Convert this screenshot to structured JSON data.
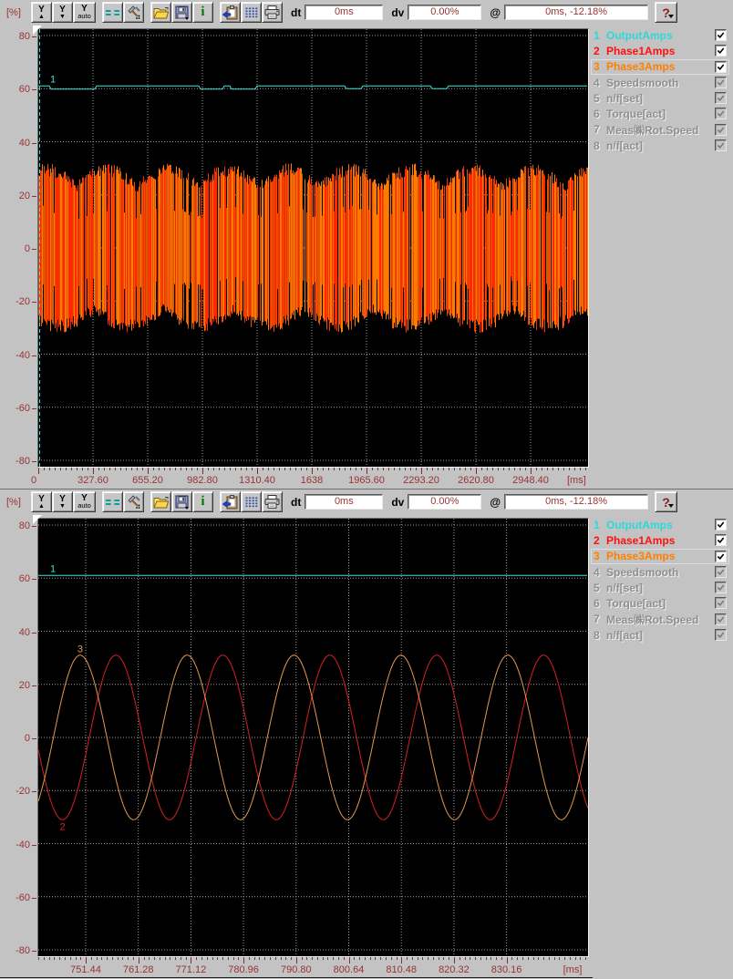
{
  "ui": {
    "btn_y": "Y",
    "btn_y_up_name": "y-zoom-in",
    "btn_y_down_name": "y-zoom-out",
    "btn_auto": "auto",
    "btn_info": "i",
    "btn_help": "?",
    "dt_label": "dt",
    "dv_label": "dv",
    "at_label": "@"
  },
  "colors": {
    "window_bg": "#c3c3c3",
    "plot_bg": "#000000",
    "grid": "#c9c9c9",
    "axis_text": "#993333",
    "cyan": "#3ce2d8",
    "red": "#ff1414",
    "orange": "#ff8214",
    "disabled_text": "#8f8f8f"
  },
  "channels": [
    {
      "num": "1",
      "name": "OutputAmps",
      "color": "#2dd8d8",
      "enabled": true,
      "checked": true,
      "selected": false
    },
    {
      "num": "2",
      "name": "Phase1Amps",
      "color": "#ff1010",
      "enabled": true,
      "checked": true,
      "selected": false
    },
    {
      "num": "3",
      "name": "Phase3Amps",
      "color": "#ff7f00",
      "enabled": true,
      "checked": true,
      "selected": true
    },
    {
      "num": "4",
      "name": "Speedsmooth",
      "color": "#8f8f8f",
      "enabled": false,
      "checked": true,
      "selected": false
    },
    {
      "num": "5",
      "name": "n/f[set]",
      "color": "#8f8f8f",
      "enabled": false,
      "checked": true,
      "selected": false
    },
    {
      "num": "6",
      "name": "Torque[act]",
      "color": "#8f8f8f",
      "enabled": false,
      "checked": true,
      "selected": false
    },
    {
      "num": "7",
      "name": "Meas㈱Rot.Speed",
      "color": "#8f8f8f",
      "enabled": false,
      "checked": true,
      "selected": false
    },
    {
      "num": "8",
      "name": "n/f[act]",
      "color": "#8f8f8f",
      "enabled": false,
      "checked": true,
      "selected": false
    }
  ],
  "panels": [
    {
      "y_unit": "[%]",
      "fields": {
        "dt": "0ms",
        "dv": "0.00%",
        "at": "0ms, -12.18%"
      }
    },
    {
      "y_unit": "[%]",
      "fields": {
        "dt": "0ms",
        "dv": "0.00%",
        "at": "0ms, -12.18%"
      }
    }
  ],
  "chart_data": [
    {
      "type": "line",
      "title": "trace overview - full record",
      "x_unit": "[ms]",
      "y_unit": "[%]",
      "x_tick_labels": [
        "0",
        "327.60",
        "655.20",
        "982.80",
        "1310.40",
        "1638",
        "1965.60",
        "2293.20",
        "2620.80",
        "2948.40"
      ],
      "x_ticks": [
        0,
        327.6,
        655.2,
        982.8,
        1310.4,
        1638,
        1965.6,
        2293.2,
        2620.8,
        2948.4
      ],
      "x_range": [
        0,
        3292.4
      ],
      "y_tick_labels": [
        "80",
        "60",
        "40",
        "20",
        "0",
        "-20",
        "-40",
        "-60",
        "-80"
      ],
      "y_ticks": [
        80,
        60,
        40,
        20,
        0,
        -20,
        -40,
        -60,
        -80
      ],
      "y_range": [
        -82.4,
        82.4
      ],
      "grid": true,
      "legend_position": "right",
      "cursor": {
        "at_ms": 0,
        "color": "#38e4e4",
        "style": "dashed"
      },
      "series": [
        {
          "name": "OutputAmps",
          "kind": "constant",
          "color": "#3ce2d8",
          "value_pct": 61,
          "curve_label": "1",
          "dips": [
            {
              "from_frac": 0.02,
              "to_frac": 0.105,
              "delta_pct": -1.2
            },
            {
              "from_frac": 0.295,
              "to_frac": 0.335,
              "delta_pct": -1.2
            },
            {
              "from_frac": 0.35,
              "to_frac": 0.395,
              "delta_pct": -1.2
            },
            {
              "from_frac": 0.56,
              "to_frac": 0.59,
              "delta_pct": -1.0
            },
            {
              "from_frac": 0.715,
              "to_frac": 0.745,
              "delta_pct": -1.0
            }
          ]
        },
        {
          "name": "Phase1Amps",
          "kind": "dense-band",
          "color": "#ff2800",
          "amplitude_pct": 32
        },
        {
          "name": "Phase3Amps",
          "kind": "dense-band",
          "color": "#ff7a00",
          "amplitude_pct": 32
        }
      ]
    },
    {
      "type": "line",
      "title": "trace zoom view",
      "x_unit": "[ms]",
      "y_unit": "[%]",
      "x_tick_labels": [
        "751.44",
        "761.28",
        "771.12",
        "780.96",
        "790.80",
        "800.64",
        "810.48",
        "820.32",
        "830.16"
      ],
      "x_ticks": [
        751.44,
        761.28,
        771.12,
        780.96,
        790.8,
        800.64,
        810.48,
        820.32,
        830.16
      ],
      "x_range": [
        742.57,
        845.4
      ],
      "y_tick_labels": [
        "80",
        "60",
        "40",
        "20",
        "0",
        "-20",
        "-40",
        "-60",
        "-80"
      ],
      "y_ticks": [
        80,
        60,
        40,
        20,
        0,
        -20,
        -40,
        -60,
        -80
      ],
      "y_range": [
        -82.4,
        82.4
      ],
      "grid": true,
      "legend_position": "right",
      "series": [
        {
          "name": "OutputAmps",
          "kind": "constant",
          "color": "#3ce2d8",
          "value_pct": 61,
          "curve_label": "1"
        },
        {
          "name": "Phase1Amps",
          "kind": "sine",
          "color": "#d42222",
          "amplitude_pct": 31,
          "period_ms": 20,
          "peak_at_ms": 757.1,
          "curve_label": "2",
          "label_anchor": "trough"
        },
        {
          "name": "Phase3Amps",
          "kind": "sine",
          "color": "#e09a50",
          "amplitude_pct": 31,
          "period_ms": 20,
          "peak_at_ms": 750.4,
          "curve_label": "3",
          "label_anchor": "peak"
        }
      ]
    }
  ]
}
